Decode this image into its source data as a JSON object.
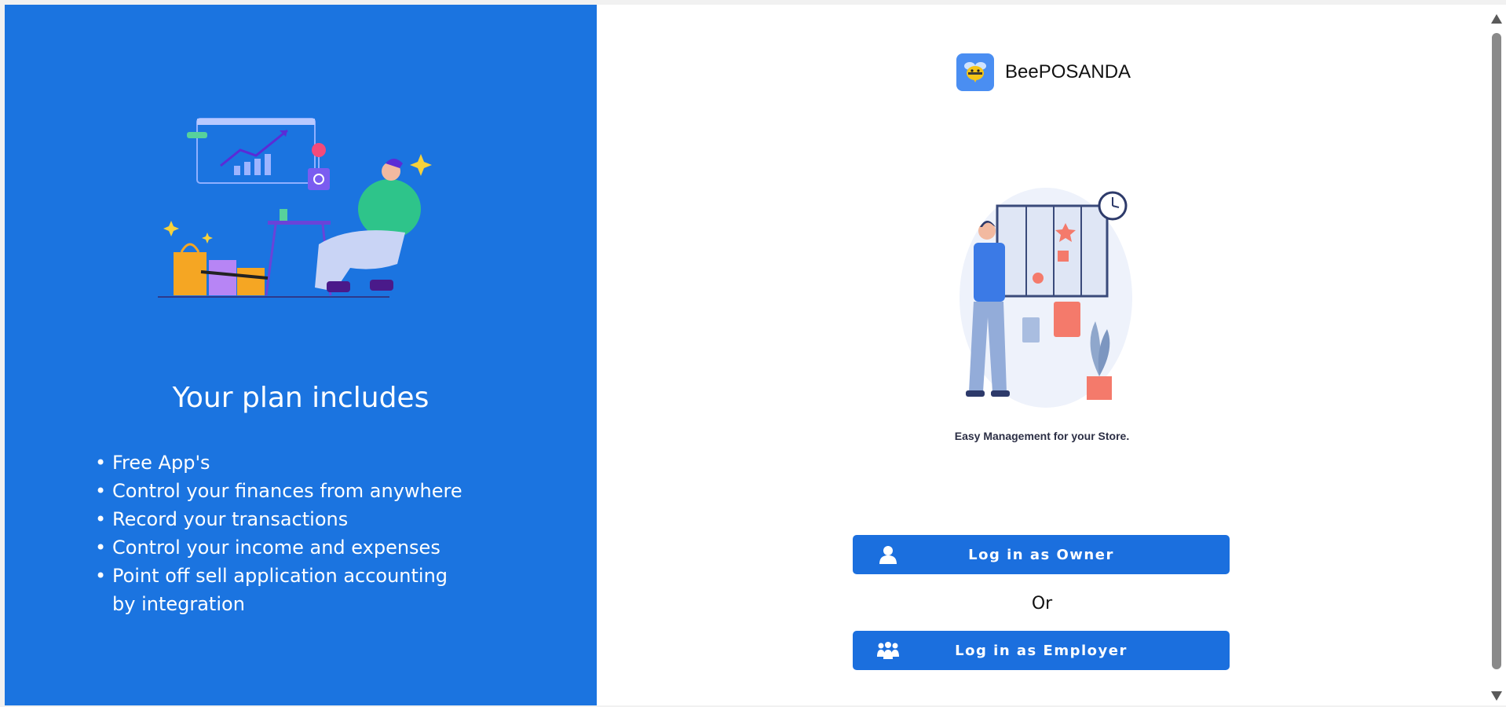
{
  "left": {
    "title": "Your plan includes",
    "features": [
      "Free App's",
      "Control your finances from anywhere",
      "Record your transactions",
      "Control your income and expenses",
      "Point off sell application accounting by integration"
    ]
  },
  "brand": {
    "name": "BeePOSANDA",
    "logo_icon": "bee-icon"
  },
  "right": {
    "tagline": "Easy Management for your Store.",
    "or_text": "Or"
  },
  "buttons": {
    "owner_label": "Log in as Owner",
    "owner_icon": "user-icon",
    "employer_label": "Log in as Employer",
    "employer_icon": "group-icon"
  },
  "colors": {
    "primary_blue": "#1b74e0",
    "button_blue": "#1b6fde",
    "logo_blue": "#4a8ef2",
    "bee_yellow": "#f5c518"
  }
}
